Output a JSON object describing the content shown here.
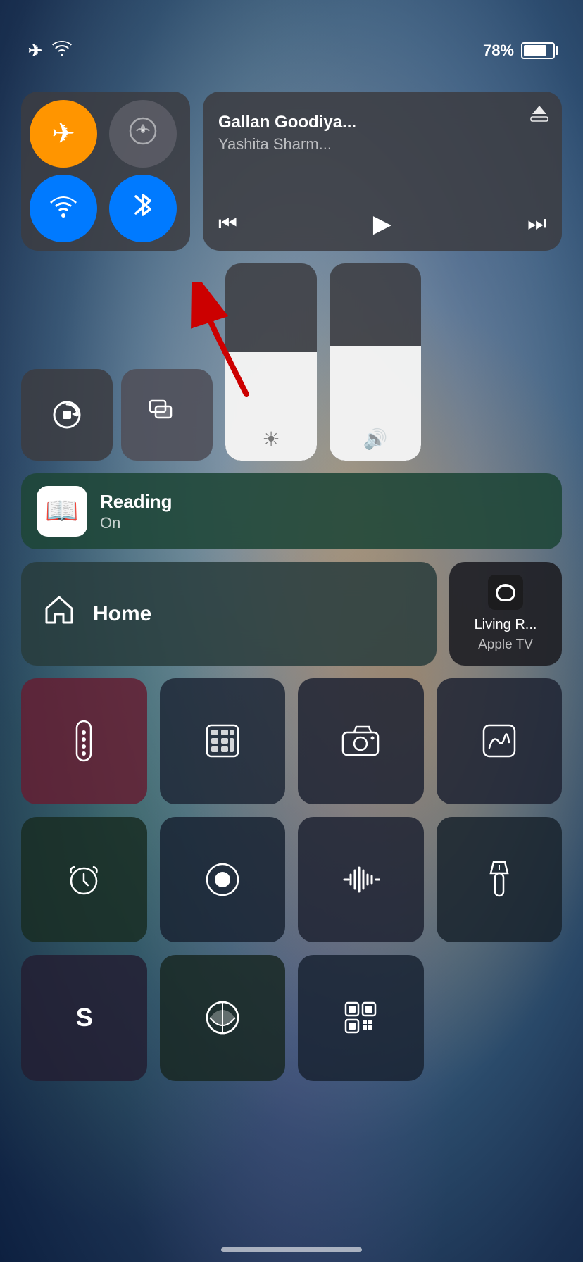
{
  "statusBar": {
    "batteryPercent": "78%",
    "airplaneMode": true,
    "wifi": true
  },
  "connectivity": {
    "airplane": {
      "active": true,
      "icon": "✈"
    },
    "cellular": {
      "active": false,
      "icon": "📡"
    },
    "wifi": {
      "active": true,
      "icon": "📶"
    },
    "bluetooth": {
      "active": true,
      "icon": "⬡"
    }
  },
  "media": {
    "title": "Gallan Goodiya...",
    "artist": "Yashita Sharm...",
    "airplayIcon": "📡"
  },
  "sliders": {
    "brightness": 55,
    "volume": 58
  },
  "readingMode": {
    "label": "Reading",
    "status": "On"
  },
  "home": {
    "label": "Home"
  },
  "appleTV": {
    "room": "Living R...",
    "device": "Apple TV"
  },
  "bottomIcons": [
    {
      "id": "remote",
      "icon": "📻",
      "colorClass": "dark1"
    },
    {
      "id": "calculator",
      "icon": "🔢",
      "colorClass": "dark2"
    },
    {
      "id": "camera",
      "icon": "📷",
      "colorClass": "dark3"
    },
    {
      "id": "signature",
      "icon": "✍",
      "colorClass": "dark4"
    },
    {
      "id": "alarm",
      "icon": "⏰",
      "colorClass": "dark5"
    },
    {
      "id": "record",
      "icon": "⏺",
      "colorClass": "dark6"
    },
    {
      "id": "soundwave",
      "icon": "〰",
      "colorClass": "dark7"
    },
    {
      "id": "flashlight",
      "icon": "🔦",
      "colorClass": "dark8"
    },
    {
      "id": "shazam",
      "icon": "S",
      "colorClass": "dark9"
    },
    {
      "id": "accessibility",
      "icon": "◑",
      "colorClass": "dark10"
    },
    {
      "id": "qrcode",
      "icon": "⊞",
      "colorClass": "dark11"
    }
  ]
}
